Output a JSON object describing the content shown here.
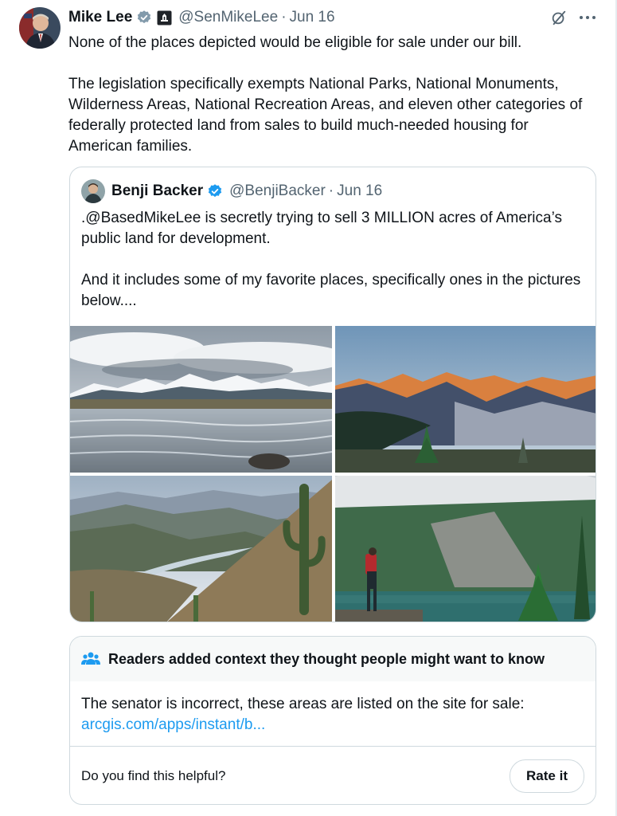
{
  "tweet": {
    "author_name": "Mike Lee",
    "handle": "@SenMikeLee",
    "separator": "·",
    "date": "Jun 16",
    "paragraphs": [
      "None of the places depicted would be eligible for sale under our bill.",
      "The legislation specifically exempts National Parks, National Monuments, Wilderness Areas, National Recreation Areas, and eleven other categories of federally protected land from sales to build much-needed housing for American families."
    ]
  },
  "quote": {
    "author_name": "Benji Backer",
    "handle": "@BenjiBacker",
    "separator": "·",
    "date": "Jun 16",
    "paragraphs": [
      ".@BasedMikeLee is secretly trying to sell 3 MILLION acres of America’s public land for development.",
      "And it includes some of my favorite places, specifically ones in the pictures below...."
    ]
  },
  "community_note": {
    "header": "Readers added context they thought people might want to know",
    "body": "The senator is incorrect, these areas are listed on the site for sale:",
    "link": "arcgis.com/apps/instant/b...",
    "question": "Do you find this helpful?",
    "rate_label": "Rate it"
  },
  "colors": {
    "accent": "#1d9bf0",
    "verified": "#1d9bf0",
    "muted": "#536471",
    "border": "#cfd9de"
  }
}
